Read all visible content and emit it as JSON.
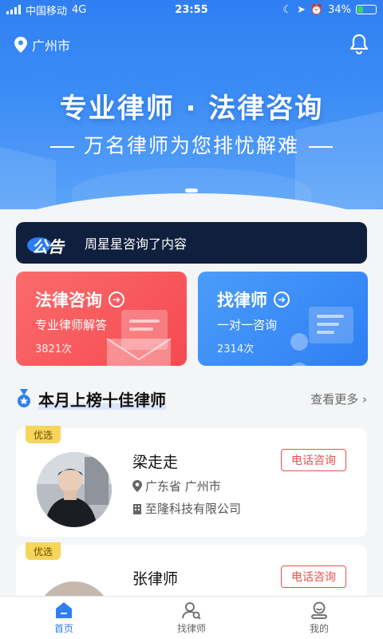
{
  "status_bar": {
    "carrier": "中国移动",
    "network": "4G",
    "time": "23:55",
    "battery": "34%",
    "battery_level": 0.34
  },
  "header": {
    "location": "广州市",
    "icons": [
      "location-pin-icon",
      "bell-icon"
    ]
  },
  "banner": {
    "slogan": "专业律师 · 法律咨询",
    "subtitle": "万名律师为您排忧解难"
  },
  "notice": {
    "tag": "公告",
    "text": "周星星咨询了内容"
  },
  "services": [
    {
      "title": "法律咨询",
      "desc": "专业律师解答",
      "count": "3821次",
      "color": "#f44a50"
    },
    {
      "title": "找律师",
      "desc": "一对一咨询",
      "count": "2314次",
      "color": "#2f7ff3"
    }
  ],
  "section": {
    "title": "本月上榜十佳律师",
    "more": "查看更多"
  },
  "lawyers": [
    {
      "badge": "优选",
      "name": "梁走走",
      "location": "广东省 广州市",
      "company": "至隆科技有限公司",
      "action": "电话咨询"
    },
    {
      "badge": "优选",
      "name": "张律师",
      "action": "电话咨询"
    }
  ],
  "tabs": [
    {
      "label": "首页",
      "icon": "home-icon",
      "active": true
    },
    {
      "label": "找律师",
      "icon": "find-lawyer-icon",
      "active": false
    },
    {
      "label": "我的",
      "icon": "profile-icon",
      "active": false
    }
  ],
  "colors": {
    "primary": "#2f7ff3",
    "danger": "#e8504f",
    "notice_bg": "#0f1f3d"
  }
}
